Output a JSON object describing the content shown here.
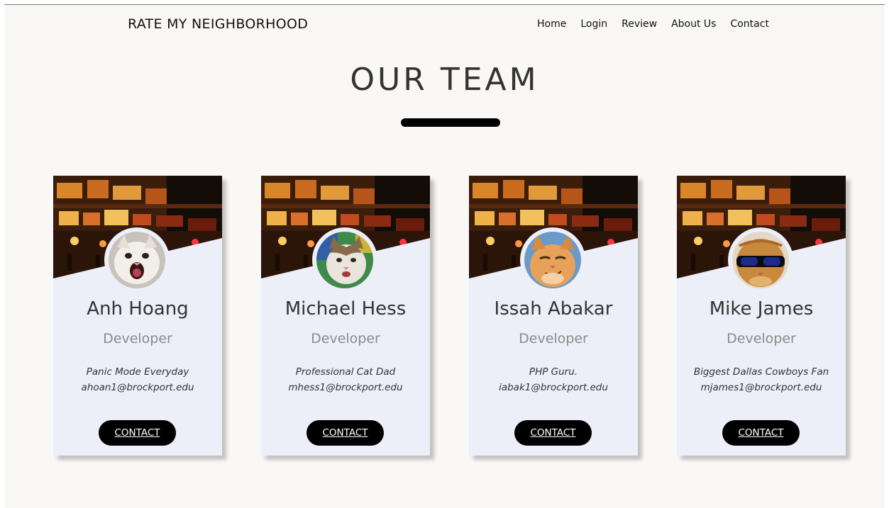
{
  "site": {
    "brand": "RATE MY NEIGHBORHOOD"
  },
  "nav": {
    "items": [
      "Home",
      "Login",
      "Review",
      "About Us",
      "Contact"
    ]
  },
  "page": {
    "title": "OUR TEAM"
  },
  "team": [
    {
      "name": "Anh Hoang",
      "role": "Developer",
      "bio": "Panic Mode Everyday",
      "email": "ahoan1@brockport.edu",
      "button": "CONTACT",
      "avatar": "screaming-white-cat"
    },
    {
      "name": "Michael Hess",
      "role": "Developer",
      "bio": "Professional Cat Dad",
      "email": "mhess1@brockport.edu",
      "button": "CONTACT",
      "avatar": "tabby-white-cat"
    },
    {
      "name": "Issah Abakar",
      "role": "Developer",
      "bio": "PHP Guru.",
      "email": "iabak1@brockport.edu",
      "button": "CONTACT",
      "avatar": "smirking-orange-cat"
    },
    {
      "name": "Mike James",
      "role": "Developer",
      "bio": "Biggest Dallas Cowboys Fan",
      "email": "mjames1@brockport.edu",
      "button": "CONTACT",
      "avatar": "orange-cat-sunglasses"
    }
  ],
  "colors": {
    "page_bg": "#f9f8f6",
    "card_bg": "#eceef8",
    "button_bg": "#000000",
    "role_text": "#8b8b8b"
  }
}
